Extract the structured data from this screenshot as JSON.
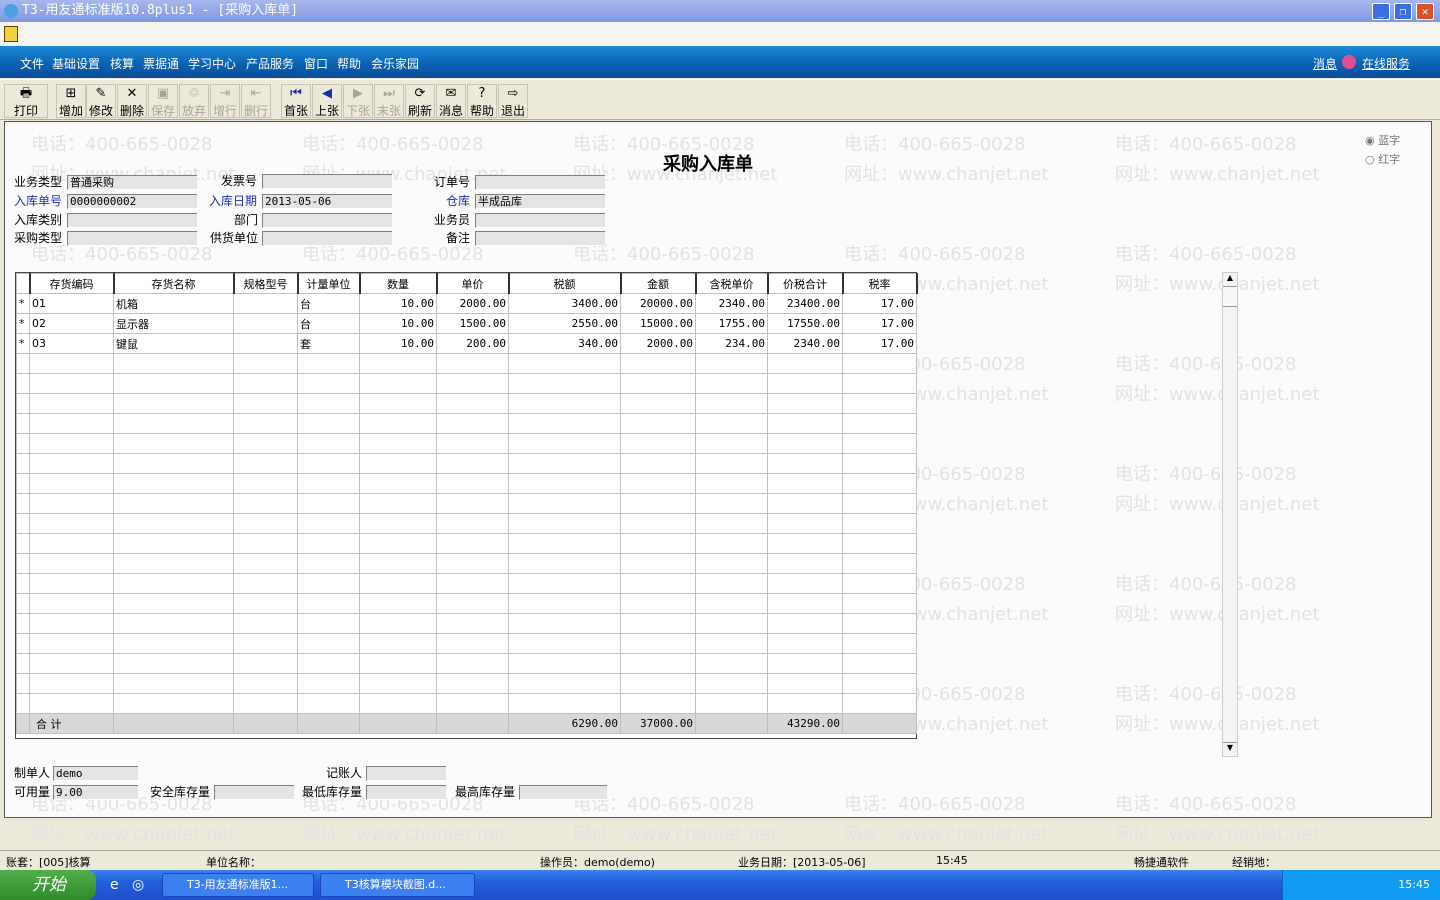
{
  "window": {
    "title": "T3-用友通标准版10.8plus1 - [采购入库单]"
  },
  "menu": {
    "items": [
      "文件",
      "基础设置",
      "核算",
      "票据通",
      "学习中心",
      "产品服务",
      "窗口",
      "帮助",
      "会乐家园"
    ],
    "message": "消息",
    "online_service": "在线服务"
  },
  "toolbar": {
    "buttons": [
      {
        "label": "打印",
        "icon": "printer-icon",
        "enabled": true
      },
      {
        "label": "增加",
        "icon": "add-icon",
        "enabled": true
      },
      {
        "label": "修改",
        "icon": "edit-icon",
        "enabled": true
      },
      {
        "label": "删除",
        "icon": "delete-icon",
        "enabled": true
      },
      {
        "label": "保存",
        "icon": "save-icon",
        "enabled": false
      },
      {
        "label": "放弃",
        "icon": "discard-icon",
        "enabled": false
      },
      {
        "label": "增行",
        "icon": "add-row-icon",
        "enabled": false
      },
      {
        "label": "删行",
        "icon": "delete-row-icon",
        "enabled": false
      },
      {
        "label": "首张",
        "icon": "first-icon",
        "enabled": true
      },
      {
        "label": "上张",
        "icon": "prev-icon",
        "enabled": true
      },
      {
        "label": "下张",
        "icon": "next-icon",
        "enabled": false
      },
      {
        "label": "末张",
        "icon": "last-icon",
        "enabled": false
      },
      {
        "label": "刷新",
        "icon": "refresh-icon",
        "enabled": true
      },
      {
        "label": "消息",
        "icon": "message-icon",
        "enabled": true
      },
      {
        "label": "帮助",
        "icon": "help-icon",
        "enabled": true
      },
      {
        "label": "退出",
        "icon": "exit-icon",
        "enabled": true
      }
    ]
  },
  "watermark": {
    "phone": "电话：400-665-0028",
    "site": "网址：www.chanjet.net"
  },
  "form": {
    "title": "采购入库单",
    "color_options": [
      "蓝字",
      "红字"
    ],
    "fields": {
      "business_type": {
        "label": "业务类型",
        "value": "普通采购"
      },
      "receipt_no": {
        "label": "入库单号",
        "value": "0000000002"
      },
      "receipt_category": {
        "label": "入库类别",
        "value": ""
      },
      "purchase_type": {
        "label": "采购类型",
        "value": ""
      },
      "invoice_no": {
        "label": "发票号",
        "value": ""
      },
      "receipt_date": {
        "label": "入库日期",
        "value": "2013-05-06"
      },
      "department": {
        "label": "部门",
        "value": ""
      },
      "supplier": {
        "label": "供货单位",
        "value": ""
      },
      "order_no": {
        "label": "订单号",
        "value": ""
      },
      "warehouse": {
        "label": "仓库",
        "value": "半成品库"
      },
      "salesperson": {
        "label": "业务员",
        "value": ""
      },
      "remarks": {
        "label": "备注",
        "value": ""
      }
    },
    "footer": {
      "maker": {
        "label": "制单人",
        "value": "demo"
      },
      "bookkeeper": {
        "label": "记账人",
        "value": ""
      },
      "available": {
        "label": "可用量",
        "value": "9.00"
      },
      "safety_stock": {
        "label": "安全库存量",
        "value": ""
      },
      "min_stock": {
        "label": "最低库存量",
        "value": ""
      },
      "max_stock": {
        "label": "最高库存量",
        "value": ""
      }
    }
  },
  "table": {
    "columns": [
      "存货编码",
      "存货名称",
      "规格型号",
      "计量单位",
      "数量",
      "单价",
      "税额",
      "金额",
      "含税单价",
      "价税合计",
      "税率"
    ],
    "rows": [
      {
        "marker": "*",
        "cells": [
          "01",
          "机箱",
          "",
          "台",
          "10.00",
          "2000.00",
          "3400.00",
          "20000.00",
          "2340.00",
          "23400.00",
          "17.00"
        ]
      },
      {
        "marker": "*",
        "cells": [
          "02",
          "显示器",
          "",
          "台",
          "10.00",
          "1500.00",
          "2550.00",
          "15000.00",
          "1755.00",
          "17550.00",
          "17.00"
        ]
      },
      {
        "marker": "*",
        "cells": [
          "03",
          "键鼠",
          "",
          "套",
          "10.00",
          "200.00",
          "340.00",
          "2000.00",
          "234.00",
          "2340.00",
          "17.00"
        ]
      }
    ],
    "total": {
      "label": "合  计",
      "cells": [
        "",
        "",
        "",
        "",
        "",
        "",
        "6290.00",
        "37000.00",
        "",
        "43290.00",
        ""
      ]
    }
  },
  "status": {
    "account": "账套：[005]核算",
    "company": "单位名称：",
    "operator": "操作员：demo(demo)",
    "business_date": "业务日期：[2013-05-06]",
    "time": "15:45",
    "software": "畅捷通软件",
    "dealer": "经销地："
  },
  "taskbar": {
    "start": "开始",
    "tasks": [
      "T3-用友通标准版1...",
      "T3核算模块截图.d..."
    ],
    "clock": "15:45"
  }
}
